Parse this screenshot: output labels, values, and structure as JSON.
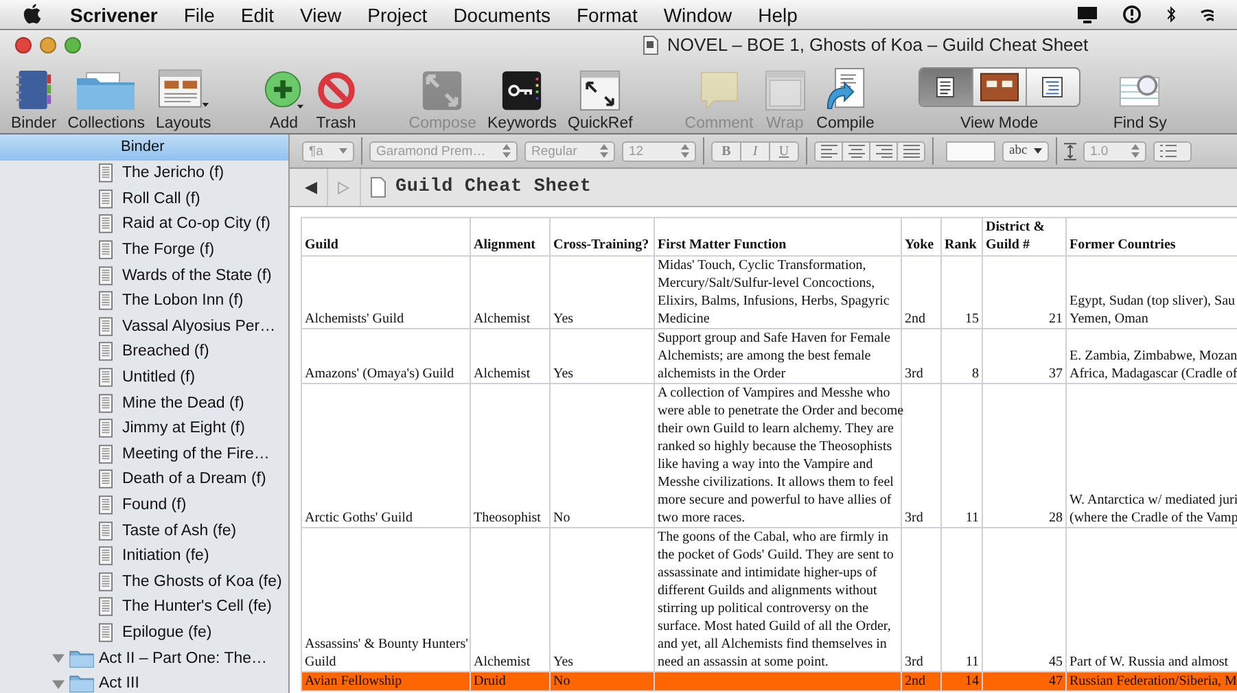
{
  "menu_bar": {
    "items": [
      {
        "label": "Scrivener",
        "kind": "app"
      },
      {
        "label": "File",
        "kind": "menu"
      },
      {
        "label": "Edit",
        "kind": "menu"
      },
      {
        "label": "View",
        "kind": "menu"
      },
      {
        "label": "Project",
        "kind": "menu"
      },
      {
        "label": "Documents",
        "kind": "menu"
      },
      {
        "label": "Format",
        "kind": "menu"
      },
      {
        "label": "Window",
        "kind": "menu"
      },
      {
        "label": "Help",
        "kind": "menu"
      }
    ]
  },
  "window": {
    "title": "NOVEL – BOE 1, Ghosts of Koa – Guild Cheat Sheet"
  },
  "toolbar": {
    "items": [
      {
        "label": "Binder",
        "kind": "binder",
        "disabled": false
      },
      {
        "label": "Collections",
        "kind": "collections",
        "disabled": false
      },
      {
        "label": "Layouts",
        "kind": "layouts",
        "disabled": false
      },
      {
        "label": "Add",
        "kind": "add",
        "disabled": false
      },
      {
        "label": "Trash",
        "kind": "trash",
        "disabled": false
      },
      {
        "label": "Compose",
        "kind": "compose",
        "disabled": true
      },
      {
        "label": "Keywords",
        "kind": "keywords",
        "disabled": false
      },
      {
        "label": "QuickRef",
        "kind": "quickref",
        "disabled": false
      },
      {
        "label": "Comment",
        "kind": "comment",
        "disabled": true
      },
      {
        "label": "Wrap",
        "kind": "wrap",
        "disabled": true
      },
      {
        "label": "Compile",
        "kind": "compile",
        "disabled": false
      },
      {
        "label": "View Mode",
        "kind": "view_mode",
        "disabled": false,
        "segments": [
          {
            "selected": true
          },
          {
            "selected": false
          },
          {
            "selected": false
          }
        ]
      },
      {
        "label": "Find Sy",
        "kind": "find",
        "disabled": false
      }
    ]
  },
  "binder": {
    "header": "Binder",
    "items": [
      {
        "label": "The Jericho (f)",
        "kind": "document"
      },
      {
        "label": "Roll Call (f)",
        "kind": "document"
      },
      {
        "label": "Raid at Co-op City (f)",
        "kind": "document"
      },
      {
        "label": "The Forge (f)",
        "kind": "document"
      },
      {
        "label": "Wards of the State (f)",
        "kind": "document"
      },
      {
        "label": "The Lobon Inn (f)",
        "kind": "document"
      },
      {
        "label": "Vassal Alyosius Per…",
        "kind": "document"
      },
      {
        "label": "Breached (f)",
        "kind": "document"
      },
      {
        "label": "Untitled (f)",
        "kind": "document"
      },
      {
        "label": "Mine the Dead (f)",
        "kind": "document"
      },
      {
        "label": "Jimmy at Eight (f)",
        "kind": "document"
      },
      {
        "label": "Meeting of the Fire…",
        "kind": "document"
      },
      {
        "label": "Death of a Dream (f)",
        "kind": "document"
      },
      {
        "label": "Found (f)",
        "kind": "document"
      },
      {
        "label": "Taste of Ash (fe)",
        "kind": "document"
      },
      {
        "label": "Initiation (fe)",
        "kind": "document"
      },
      {
        "label": "The Ghosts of Koa (fe)",
        "kind": "document"
      },
      {
        "label": "The Hunter's Cell (fe)",
        "kind": "document"
      },
      {
        "label": "Epilogue (fe)",
        "kind": "document"
      },
      {
        "label": "Act II – Part One: The…",
        "kind": "folder",
        "expanded": true
      },
      {
        "label": "Act III",
        "kind": "folder",
        "expanded": true
      }
    ]
  },
  "format_bar": {
    "paragraph_style": "¶a",
    "font": "Garamond Prem…",
    "typeface": "Regular",
    "size": "12",
    "styles": [
      "B",
      "I",
      "U"
    ],
    "highlight": "abc",
    "line_spacing": "1.0"
  },
  "editor": {
    "title": "Guild Cheat Sheet"
  },
  "table": {
    "columns": [
      "Guild",
      "Alignment",
      "Cross-Training?",
      "First Matter Function",
      "Yoke",
      "Rank",
      "District &\nGuild #",
      "Former Countries"
    ],
    "rows": [
      {
        "cells": [
          "Alchemists' Guild",
          "Alchemist",
          "Yes",
          "Midas' Touch, Cyclic Transformation,\nMercury/Salt/Sulfur-level Concoctions,\nElixirs, Balms, Infusions, Herbs, Spagyric\nMedicine",
          "2nd",
          "15",
          "21",
          "Egypt, Sudan (top sliver), Sau\nYemen, Oman"
        ]
      },
      {
        "cells": [
          "Amazons' (Omaya's) Guild",
          "Alchemist",
          "Yes",
          "Support group and Safe Haven for Female\nAlchemists; are among the best female\nalchemists in the Order",
          "3rd",
          "8",
          "37",
          "E. Zambia, Zimbabwe, Mozan\nAfrica, Madagascar (Cradle of"
        ]
      },
      {
        "cells": [
          "Arctic Goths' Guild",
          "Theosophist",
          "No",
          "A collection of Vampires and Messhe who\nwere able to penetrate the Order and become\ntheir own Guild to learn alchemy. They are\nranked so highly because the Theosophists\nlike having a way into the Vampire and\nMesshe civilizations. It allows them to feel\nmore secure and powerful to have allies of\ntwo more races.",
          "3rd",
          "11",
          "28",
          "W. Antarctica w/ mediated juri\n(where the Cradle of the Vamp"
        ]
      },
      {
        "cells": [
          "Assassins' & Bounty Hunters'\nGuild",
          "Alchemist",
          "Yes",
          "The goons of the Cabal, who are firmly in\nthe pocket of Gods' Guild. They are sent to\nassassinate and intimidate higher-ups of\ndifferent Guilds and alignments without\nstirring up political controversy on the\nsurface. Most hated Guild of all the Order,\nand yet, all Alchemists find themselves in\nneed an assassin at some point.",
          "3rd",
          "11",
          "45",
          "Part of W. Russia and almost"
        ]
      },
      {
        "cells": [
          "Avian Fellowship",
          "Druid",
          "No",
          null,
          "2nd",
          "14",
          "47",
          "Russian Federation/Siberia, M"
        ],
        "color": "#ff6600"
      }
    ]
  }
}
